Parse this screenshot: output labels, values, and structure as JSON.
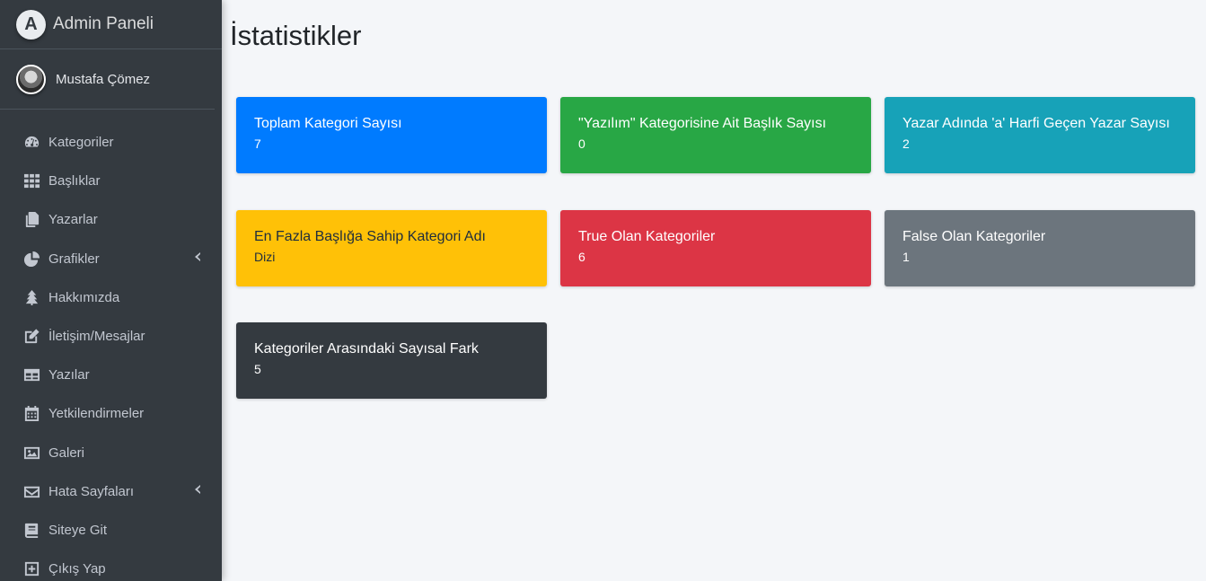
{
  "brand": {
    "logo": "A",
    "title": "Admin Paneli"
  },
  "user": {
    "name": "Mustafa Çömez"
  },
  "nav": [
    {
      "label": "Kategoriler",
      "icon": "dashboard-icon"
    },
    {
      "label": "Başlıklar",
      "icon": "grid-icon"
    },
    {
      "label": "Yazarlar",
      "icon": "copy-icon"
    },
    {
      "label": "Grafikler",
      "icon": "pie-chart-icon",
      "expandable": true
    },
    {
      "label": "Hakkımızda",
      "icon": "tree-icon"
    },
    {
      "label": "İletişim/Mesajlar",
      "icon": "edit-icon"
    },
    {
      "label": "Yazılar",
      "icon": "table-icon"
    },
    {
      "label": "Yetkilendirmeler",
      "icon": "calendar-icon"
    },
    {
      "label": "Galeri",
      "icon": "image-icon"
    },
    {
      "label": "Hata Sayfaları",
      "icon": "envelope-icon",
      "expandable": true
    },
    {
      "label": "Siteye Git",
      "icon": "book-icon"
    },
    {
      "label": "Çıkış Yap",
      "icon": "plus-square-icon"
    }
  ],
  "page": {
    "title": "İstatistikler"
  },
  "cards": [
    {
      "title": "Toplam Kategori Sayısı",
      "value": "7",
      "color": "#007bff"
    },
    {
      "title": "\"Yazılım\" Kategorisine Ait Başlık Sayısı",
      "value": "0",
      "color": "#28a745"
    },
    {
      "title": "Yazar Adında 'a' Harfi Geçen Yazar Sayısı",
      "value": "2",
      "color": "#17a2b8"
    },
    {
      "title": "En Fazla Başlığa Sahip Kategori Adı",
      "value": "Dizi",
      "color": "#ffc107"
    },
    {
      "title": "True Olan Kategoriler",
      "value": "6",
      "color": "#dc3545"
    },
    {
      "title": "False Olan Kategoriler",
      "value": "1",
      "color": "#6c757d"
    },
    {
      "title": "Kategoriler Arasındaki Sayısal Fark",
      "value": "5",
      "color": "#343a40"
    }
  ]
}
